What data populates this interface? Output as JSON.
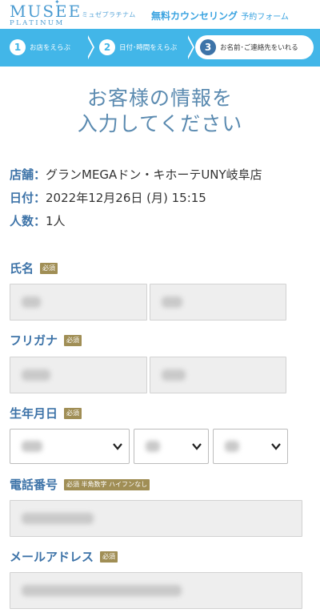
{
  "header": {
    "logo_top": "MUSEE",
    "logo_bottom": "PLATINUM",
    "logo_kana": "ミュゼプラチナム",
    "title": "無料カウンセリング",
    "title_sub": "予約フォーム"
  },
  "steps": [
    {
      "num": "1",
      "label": "お店をえらぶ"
    },
    {
      "num": "2",
      "label": "日付･時間をえらぶ"
    },
    {
      "num": "3",
      "label": "お名前･ご連絡先をいれる"
    }
  ],
  "title": {
    "line1": "お客様の情報を",
    "line2": "入力してください"
  },
  "booking": {
    "store_key": "店舗：",
    "store": "グランMEGAドン・キホーテUNY岐阜店",
    "date_key": "日付：",
    "date": "2022年12月26日 (月) 15:15",
    "people_key": "人数：",
    "people": "1人"
  },
  "form": {
    "name_label": "氏名",
    "kana_label": "フリガナ",
    "birth_label": "生年月日",
    "phone_label": "電話番号",
    "email_label": "メールアドレス",
    "required": "必須",
    "phone_note": "必須 半角数字 ハイフンなし"
  },
  "colors": {
    "accent": "#42b6e8",
    "label": "#3d73a8",
    "badge": "#a08e55",
    "title": "#5a8ab0"
  }
}
